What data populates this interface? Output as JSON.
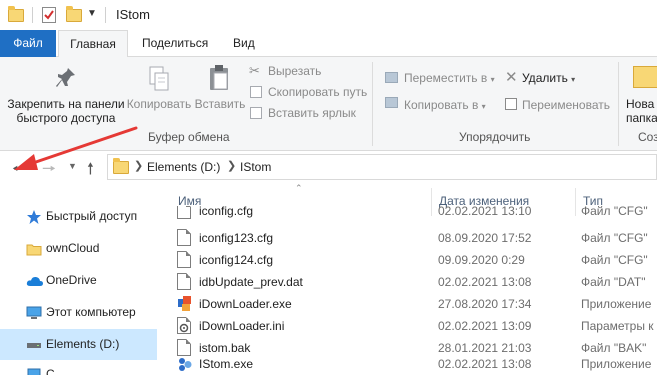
{
  "window": {
    "title": "IStom"
  },
  "ribbon_tabs": [
    "Файл",
    "Главная",
    "Поделиться",
    "Вид"
  ],
  "ribbon": {
    "clipboard": {
      "pin_label_line1": "Закрепить на панели",
      "pin_label_line2": "быстрого доступа",
      "copy": "Копировать",
      "paste": "Вставить",
      "cut": "Вырезать",
      "copy_path": "Скопировать путь",
      "paste_shortcut": "Вставить ярлык",
      "group": "Буфер обмена"
    },
    "organize": {
      "move_to": "Переместить в",
      "copy_to": "Копировать в",
      "delete": "Удалить",
      "rename": "Переименовать",
      "group": "Упорядочить"
    },
    "new": {
      "new_folder_line1": "Нова",
      "new_folder_line2": "папка",
      "group": "Соз"
    }
  },
  "address": {
    "crumbs": [
      "Elements (D:)",
      "IStom"
    ]
  },
  "nav_pane": {
    "items": [
      {
        "label": "Быстрый доступ",
        "icon": "star-icon"
      },
      {
        "label": "ownCloud",
        "icon": "folder-icon"
      },
      {
        "label": "OneDrive",
        "icon": "cloud-icon"
      },
      {
        "label": "Этот компьютер",
        "icon": "computer-icon"
      },
      {
        "label": "Elements (D:)",
        "icon": "drive-icon",
        "selected": true
      },
      {
        "label": "С",
        "icon": "network-icon"
      }
    ]
  },
  "columns": {
    "name": "Имя",
    "date": "Дата изменения",
    "type": "Тип"
  },
  "files": [
    {
      "name": "iconfig.cfg",
      "date": "02.02.2021 13:10",
      "type": "Файл \"CFG\"",
      "icon": "document-icon"
    },
    {
      "name": "iconfig123.cfg",
      "date": "08.09.2020 17:52",
      "type": "Файл \"CFG\"",
      "icon": "document-icon"
    },
    {
      "name": "iconfig124.cfg",
      "date": "09.09.2020 0:29",
      "type": "Файл \"CFG\"",
      "icon": "document-icon"
    },
    {
      "name": "idbUpdate_prev.dat",
      "date": "02.02.2021 13:08",
      "type": "Файл \"DAT\"",
      "icon": "document-icon"
    },
    {
      "name": "iDownLoader.exe",
      "date": "27.08.2020 17:34",
      "type": "Приложение",
      "icon": "app-icon"
    },
    {
      "name": "iDownLoader.ini",
      "date": "02.02.2021 13:09",
      "type": "Параметры к",
      "icon": "settings-file-icon"
    },
    {
      "name": "istom.bak",
      "date": "28.01.2021 21:03",
      "type": "Файл \"BAK\"",
      "icon": "document-icon"
    },
    {
      "name": "IStom.exe",
      "date": "02.02.2021 13:08",
      "type": "Приложение",
      "icon": "istom-app-icon"
    }
  ],
  "colors": {
    "accent": "#1f6fc4",
    "selection": "#cce8ff",
    "annotation": "#e53935"
  }
}
